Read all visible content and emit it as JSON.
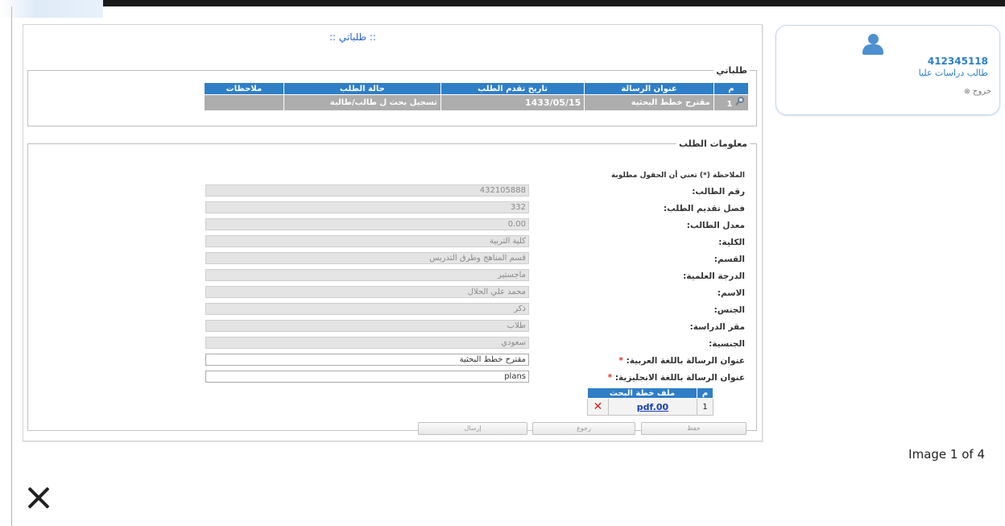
{
  "user": {
    "id": "412345118",
    "role": "طالب دراسات عليا",
    "logout_label": "خروج"
  },
  "panel": {
    "title": ":: طلباتي ::"
  },
  "requests": {
    "legend": "طلباتي",
    "columns": [
      "م",
      "عنوان الرسالة",
      "تاريخ تقدم الطلب",
      "حالة الطلب",
      "ملاحظات"
    ],
    "rows": [
      {
        "num": "1",
        "title": "مقترح خطط البحثية",
        "date": "1433/05/15",
        "status": "تسجيل بحث ل طالب/طالبة",
        "notes": ""
      }
    ]
  },
  "info": {
    "legend": "معلومات الطلب",
    "note": "الملاحظة (*) تعني أن الحقول مطلوبة",
    "fields": [
      {
        "label": "رقم الطالب:",
        "value": "432105888"
      },
      {
        "label": "فصل تقديم الطلب:",
        "value": "332"
      },
      {
        "label": "معدل الطالب:",
        "value": "0.00"
      },
      {
        "label": "الكلية:",
        "value": "كلية التربية"
      },
      {
        "label": "القسم:",
        "value": "قسم المناهج وطرق التدريس"
      },
      {
        "label": "الدرجة العلمية:",
        "value": "ماجستير"
      },
      {
        "label": "الاسم:",
        "value": "محمد علي الحلال"
      },
      {
        "label": "الجنس:",
        "value": "ذكر"
      },
      {
        "label": "مقر الدراسة:",
        "value": "طلاب"
      },
      {
        "label": "الجنسية:",
        "value": "سعودي"
      }
    ],
    "title_ar": {
      "label": "عنوان الرسالة باللغة العربية:",
      "required": "*",
      "value": "مقترح خطط البحثية"
    },
    "title_en": {
      "label": "عنوان الرسالة باللغة الانجليزية:",
      "required": "*",
      "value": "plans"
    }
  },
  "files": {
    "columns": [
      "م",
      "ملف خطة البحث"
    ],
    "rows": [
      {
        "num": "1",
        "file": "pdf.00"
      }
    ]
  },
  "buttons": {
    "save": "حفظ",
    "back": "رجوع",
    "send": "إرسال"
  },
  "viewer": {
    "caption": "Image 1 of 4",
    "close_icon": "close-icon"
  }
}
